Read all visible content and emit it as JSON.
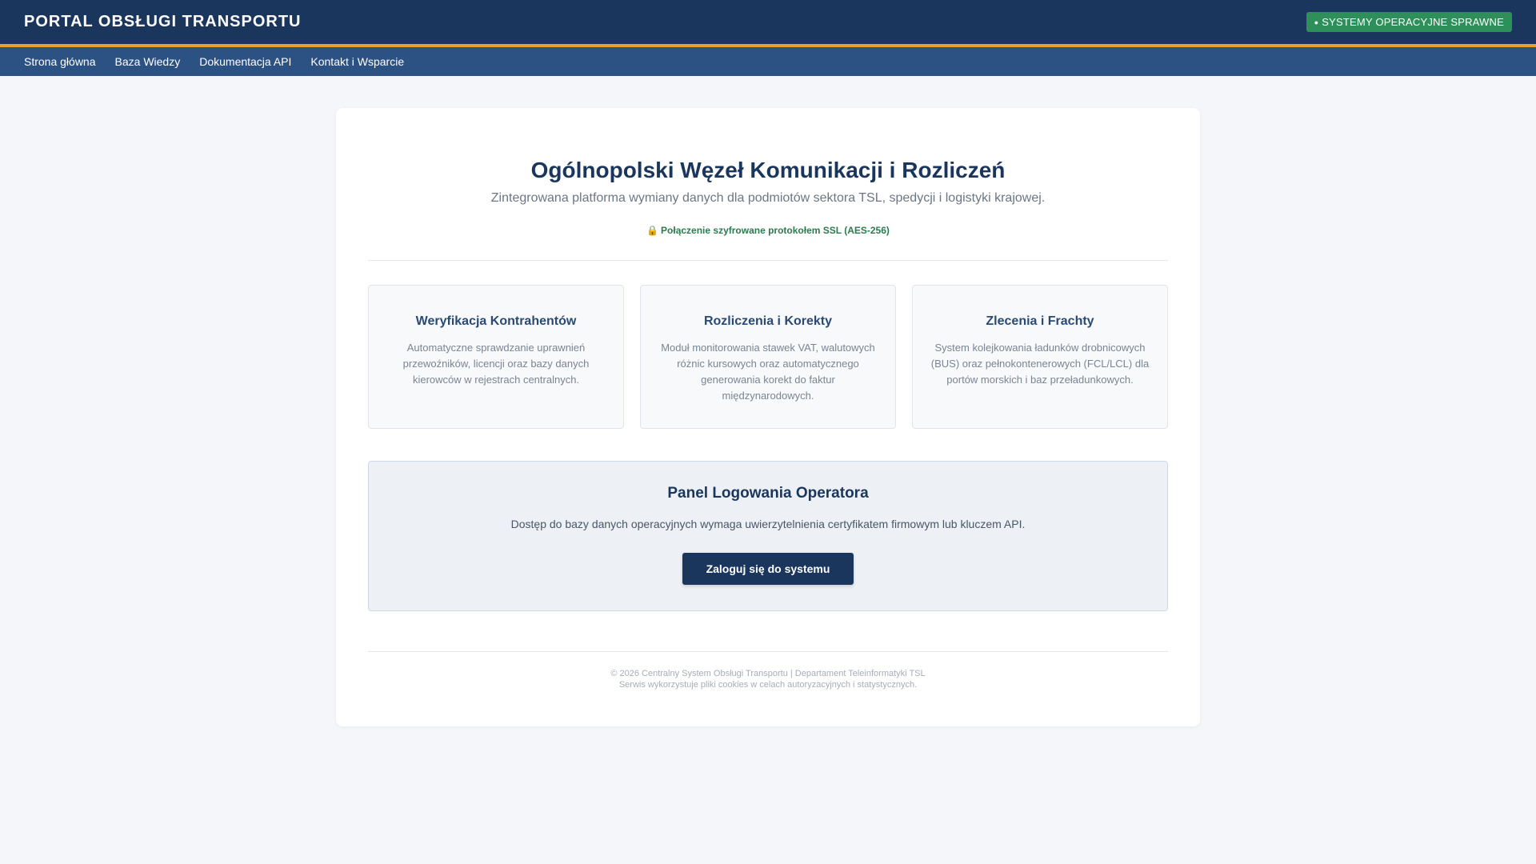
{
  "header": {
    "title": "PORTAL OBSŁUGI TRANSPORTU",
    "status_badge": "SYSTEMY OPERACYJNE SPRAWNE"
  },
  "nav": {
    "items": [
      {
        "label": "Strona główna"
      },
      {
        "label": "Baza Wiedzy"
      },
      {
        "label": "Dokumentacja API"
      },
      {
        "label": "Kontakt i Wsparcie"
      }
    ]
  },
  "hero": {
    "title": "Ogólnopolski Węzeł Komunikacji i Rozliczeń",
    "subtitle": "Zintegrowana platforma wymiany danych dla podmiotów sektora TSL, spedycji i logistyki krajowej.",
    "ssl_note": "Połączenie szyfrowane protokołem SSL (AES-256)"
  },
  "features": [
    {
      "title": "Weryfikacja Kontrahentów",
      "description": "Automatyczne sprawdzanie uprawnień przewoźników, licencji oraz bazy danych kierowców w rejestrach centralnych."
    },
    {
      "title": "Rozliczenia i Korekty",
      "description": "Moduł monitorowania stawek VAT, walutowych różnic kursowych oraz automatycznego generowania korekt do faktur międzynarodowych."
    },
    {
      "title": "Zlecenia i Frachty",
      "description": "System kolejkowania ładunków drobnicowych (BUS) oraz pełnokontenerowych (FCL/LCL) dla portów morskich i baz przeładunkowych."
    }
  ],
  "login": {
    "title": "Panel Logowania Operatora",
    "description": "Dostęp do bazy danych operacyjnych wymaga uwierzytelnienia certyfikatem firmowym lub kluczem API.",
    "button_label": "Zaloguj się do systemu"
  },
  "footer": {
    "line1": "© 2026 Centralny System Obsługi Transportu | Departament Teleinformatyki TSL",
    "line2": "Serwis wykorzystuje pliki cookies w celach autoryzacyjnych i statystycznych."
  },
  "colors": {
    "header_bg": "#1b365d",
    "nav_bg": "#2c5183",
    "accent_border": "#e5a22d",
    "status_green": "#2f8f5b",
    "ssl_green": "#2d7a4f"
  },
  "icons": {
    "status": "dot-icon",
    "ssl": "lock-icon"
  }
}
